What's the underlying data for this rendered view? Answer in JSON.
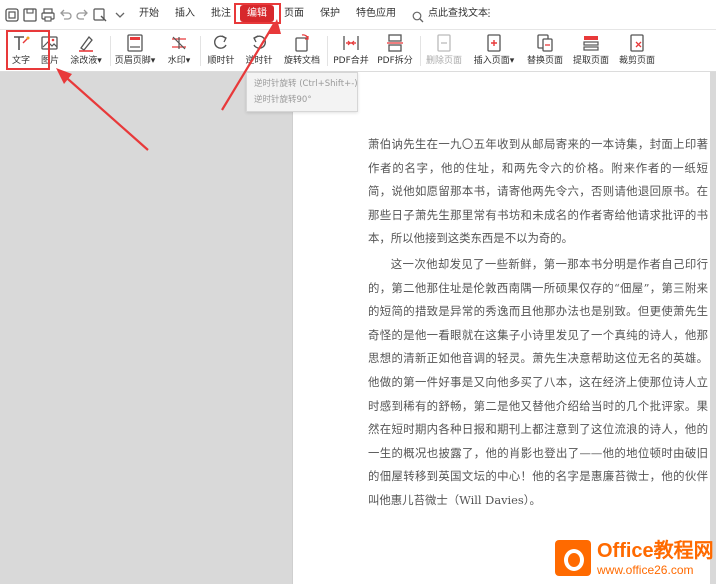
{
  "menu": {
    "items": [
      "开始",
      "插入",
      "批注",
      "编辑",
      "页面",
      "保护",
      "特色应用"
    ],
    "active": "编辑",
    "search_label": "点此查找文本",
    "more": "⋮"
  },
  "toolbar": {
    "items": [
      {
        "label": "文字",
        "icon": "text-edit-icon"
      },
      {
        "label": "图片",
        "icon": "image-edit-icon"
      },
      {
        "label": "涂改液",
        "icon": "correction-pen-icon",
        "dropdown": "▾"
      },
      {
        "label": "页眉页脚",
        "icon": "header-footer-icon",
        "dropdown": "▾"
      },
      {
        "label": "水印",
        "icon": "watermark-icon",
        "dropdown": "▾"
      },
      {
        "label": "顺时针",
        "icon": "rotate-clockwise-icon"
      },
      {
        "label": "逆时针",
        "icon": "rotate-counterclockwise-icon"
      },
      {
        "label": "旋转文档",
        "icon": "rotate-document-icon"
      },
      {
        "label": "PDF合并",
        "icon": "pdf-merge-icon"
      },
      {
        "label": "PDF拆分",
        "icon": "pdf-split-icon"
      },
      {
        "label": "删除页面",
        "icon": "delete-page-icon",
        "disabled": true
      },
      {
        "label": "插入页面",
        "icon": "insert-page-icon",
        "dropdown": "▾"
      },
      {
        "label": "替换页面",
        "icon": "replace-page-icon"
      },
      {
        "label": "提取页面",
        "icon": "extract-page-icon"
      },
      {
        "label": "裁剪页面",
        "icon": "crop-page-icon"
      }
    ]
  },
  "tooltip": {
    "line1": "逆时针旋转 (Ctrl+Shift+-)",
    "line2": "逆时针旋转90°"
  },
  "document": {
    "paragraphs": [
      "萧伯讷先生在一九〇五年收到从邮局寄来的一本诗集，封面上印著作者的名字，他的住址，和两先令六的价格。附来作者的一纸短简，说他如愿留那本书，请寄他两先令六，否则请他退回原书。在那些日子萧先生那里常有书坊和未成名的作者寄给他请求批评的书本，所以他接到这类东西是不以为奇的。",
      "这一次他却发见了一些新鲜，第一那本书分明是作者自己印行的，第二他那住址是伦敦西南隅一所硕果仅存的“佃屋”，第三附来的短简的措致是异常的秀逸而且他那办法也是别致。但更使萧先生奇怪的是他一看眼就在这集子小诗里发见了一个真纯的诗人，他那思想的清新正如他音调的轻灵。萧先生决意帮助这位无名的英雄。他做的第一件好事是又向他多买了八本，这在经济上使那位诗人立时感到稀有的舒畅，第二是他又替他介绍给当时的几个批评家。果然在短时期内各种日报和期刊上都注意到了这位流浪的诗人，他的一生的概况也披露了，他的肖影也登出了——他的地位顿时由破旧的佃屋转移到英国文坛的中心！他的名字是惠廉苔微士，他的伙伴叫他惠儿苔微士（Will Davies）。"
    ]
  },
  "watermark": {
    "title": "Office教程网",
    "url": "www.office26.com"
  },
  "colors": {
    "accent_red": "#d7282c",
    "annotation_red": "#e8393a",
    "watermark_orange": "#ff6a00",
    "workspace_gray": "#d9d9d9"
  }
}
